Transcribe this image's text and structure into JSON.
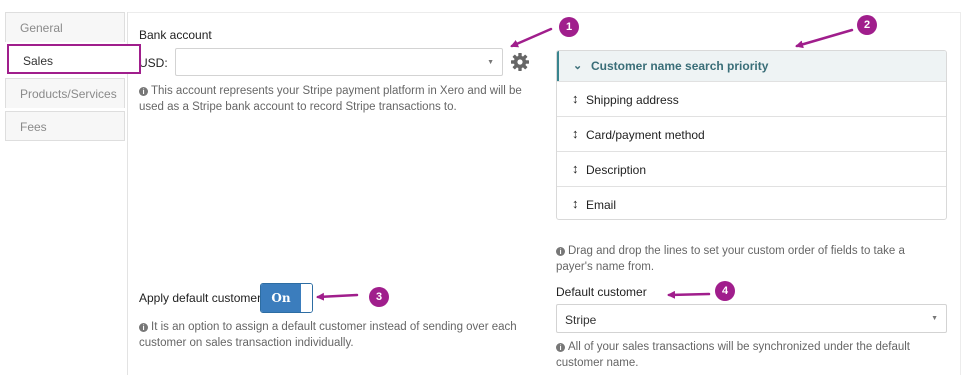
{
  "nav": {
    "items": [
      {
        "label": "General"
      },
      {
        "label": "Sales"
      },
      {
        "label": "Products/Services"
      },
      {
        "label": "Fees"
      }
    ],
    "active": "Sales"
  },
  "bank_account": {
    "title": "Bank account",
    "currency_label": "USD:",
    "selected_value": "",
    "info": "This account represents your Stripe payment platform in Xero and will be used as a Stripe bank account to record Stripe transactions to."
  },
  "priority": {
    "title": "Customer name search priority",
    "items": [
      {
        "label": "Shipping address"
      },
      {
        "label": "Card/payment method"
      },
      {
        "label": "Description"
      },
      {
        "label": "Email"
      }
    ],
    "info": "Drag and drop the lines to set your custom order of fields to take a payer's name from."
  },
  "default_customer_toggle": {
    "label": "Apply default customer",
    "state": "On",
    "info": "It is an option to assign a default customer instead of sending over each customer on sales transaction individually."
  },
  "default_customer": {
    "label": "Default customer",
    "selected_value": "Stripe",
    "info": "All of your sales transactions will be synchronized under the default customer name."
  },
  "callouts": [
    "1",
    "2",
    "3",
    "4"
  ],
  "colors": {
    "accent": "#a01e8c",
    "panel_header_text": "#3a6e78",
    "toggle_on": "#3b7dbd"
  }
}
